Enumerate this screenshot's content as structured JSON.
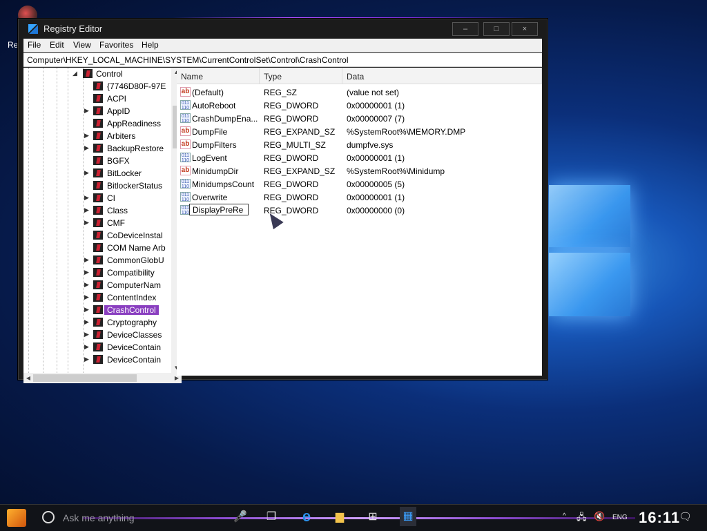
{
  "desktop": {
    "icon_label": "Re"
  },
  "window": {
    "title": "Registry Editor",
    "minimize": "–",
    "maximize": "□",
    "close": "×"
  },
  "menu": [
    "File",
    "Edit",
    "View",
    "Favorites",
    "Help"
  ],
  "address": "Computer\\HKEY_LOCAL_MACHINE\\SYSTEM\\CurrentControlSet\\Control\\CrashControl",
  "tree": {
    "root": "Control",
    "items": [
      "{7746D80F-97E",
      "ACPI",
      "AppID",
      "AppReadiness",
      "Arbiters",
      "BackupRestore",
      "BGFX",
      "BitLocker",
      "BitlockerStatus",
      "CI",
      "Class",
      "CMF",
      "CoDeviceInstal",
      "COM Name Arb",
      "CommonGlobU",
      "Compatibility",
      "ComputerNam",
      "ContentIndex",
      "CrashControl",
      "Cryptography",
      "DeviceClasses",
      "DeviceContain",
      "DeviceContain"
    ],
    "selected": "CrashControl"
  },
  "columns": [
    "Name",
    "Type",
    "Data"
  ],
  "values": [
    {
      "name": "(Default)",
      "type": "REG_SZ",
      "data": "(value not set)",
      "icon": "ab"
    },
    {
      "name": "AutoReboot",
      "type": "REG_DWORD",
      "data": "0x00000001 (1)",
      "icon": "011"
    },
    {
      "name": "CrashDumpEna...",
      "type": "REG_DWORD",
      "data": "0x00000007 (7)",
      "icon": "011"
    },
    {
      "name": "DumpFile",
      "type": "REG_EXPAND_SZ",
      "data": "%SystemRoot%\\MEMORY.DMP",
      "icon": "ab"
    },
    {
      "name": "DumpFilters",
      "type": "REG_MULTI_SZ",
      "data": "dumpfve.sys",
      "icon": "ab"
    },
    {
      "name": "LogEvent",
      "type": "REG_DWORD",
      "data": "0x00000001 (1)",
      "icon": "011"
    },
    {
      "name": "MinidumpDir",
      "type": "REG_EXPAND_SZ",
      "data": "%SystemRoot%\\Minidump",
      "icon": "ab"
    },
    {
      "name": "MinidumpsCount",
      "type": "REG_DWORD",
      "data": "0x00000005 (5)",
      "icon": "011"
    },
    {
      "name": "Overwrite",
      "type": "REG_DWORD",
      "data": "0x00000001 (1)",
      "icon": "011"
    },
    {
      "name": "DisplayPreRe",
      "type": "REG_DWORD",
      "data": "0x00000000 (0)",
      "icon": "011"
    }
  ],
  "taskbar": {
    "search_placeholder": "Ask me anything",
    "lang": "ENG",
    "clock": "16:11"
  },
  "colors": {
    "selection": "#8a3fc0",
    "accent_glow": "#b14dff"
  }
}
